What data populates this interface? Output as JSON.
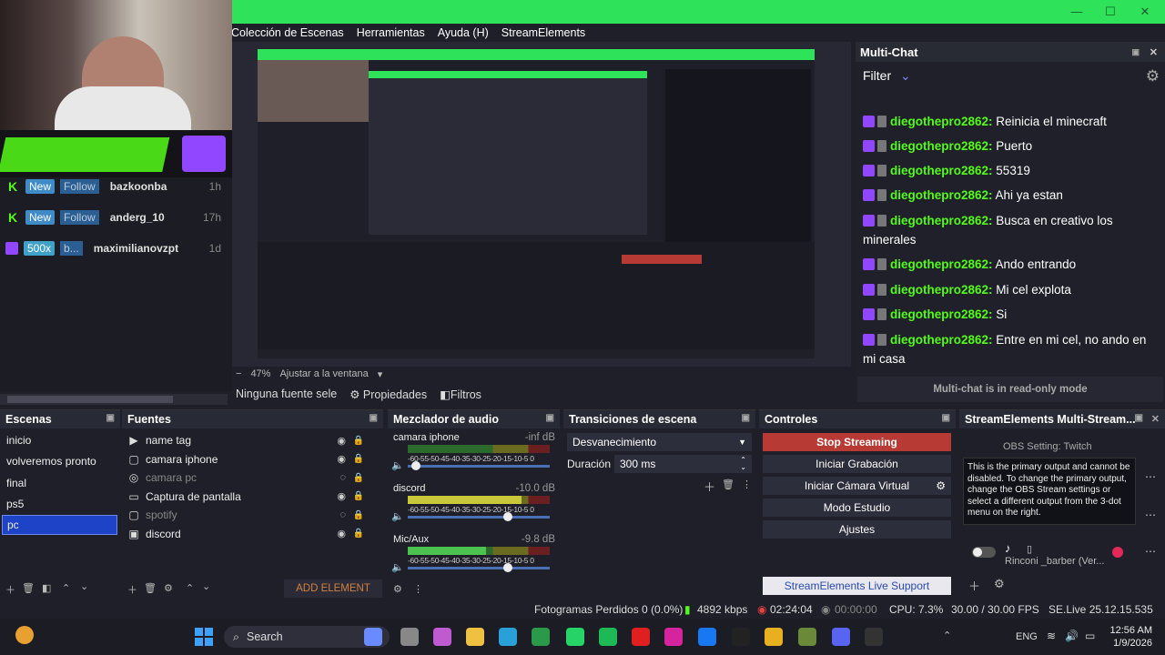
{
  "window": {
    "min": "—",
    "max": "☐",
    "close": "✕"
  },
  "menu": [
    "Colección de Escenas",
    "Herramientas",
    "Ayuda (H)",
    "StreamElements"
  ],
  "sidebar": {
    "rows": [
      {
        "platform": "kick",
        "badge": "New",
        "action": "Follow",
        "name": "bazkoonba",
        "time": "1h"
      },
      {
        "platform": "kick",
        "badge": "New",
        "action": "Follow",
        "name": "anderg_10",
        "time": "17h"
      },
      {
        "platform": "twitch",
        "badge": "500x",
        "action": "b...",
        "name": "maximilianovzpt",
        "time": "1d"
      }
    ]
  },
  "preview": {
    "zoom": "47%",
    "fit": "Ajustar a la ventana"
  },
  "sourcebar": {
    "none": "Ninguna fuente sele",
    "properties": "Propiedades",
    "filters": "Filtros"
  },
  "chat": {
    "title": "Multi-Chat",
    "filter": "Filter",
    "footer": "Multi-chat is in read-only mode",
    "messages": [
      {
        "user": "diegothepro2862:",
        "text": "Reinicia el minecraft"
      },
      {
        "user": "diegothepro2862:",
        "text": "Puerto"
      },
      {
        "user": "diegothepro2862:",
        "text": "55319"
      },
      {
        "user": "diegothepro2862:",
        "text": "Ahi ya estan"
      },
      {
        "user": "diegothepro2862:",
        "text": "Busca en creativo los minerales"
      },
      {
        "user": "diegothepro2862:",
        "text": "Ando entrando"
      },
      {
        "user": "diegothepro2862:",
        "text": "Mi cel explota"
      },
      {
        "user": "diegothepro2862:",
        "text": "Si"
      },
      {
        "user": "diegothepro2862:",
        "text": "Entre en mi cel, no ando en mi casa"
      }
    ]
  },
  "scenes": {
    "title": "Escenas",
    "items": [
      "inicio",
      "volveremos pronto",
      "final",
      "ps5",
      "pc"
    ],
    "selected": "pc"
  },
  "sources": {
    "title": "Fuentes",
    "add": "ADD ELEMENT",
    "items": [
      {
        "name": "name tag",
        "icon": "▶",
        "hidden": false
      },
      {
        "name": "camara iphone",
        "icon": "▢",
        "hidden": false
      },
      {
        "name": "camara pc",
        "icon": "◎",
        "hidden": true
      },
      {
        "name": "Captura de pantalla",
        "icon": "▭",
        "hidden": false
      },
      {
        "name": "spotify",
        "icon": "▢",
        "hidden": true
      },
      {
        "name": "discord",
        "icon": "▣",
        "hidden": false
      }
    ]
  },
  "mixer": {
    "title": "Mezclador de audio",
    "ticks": "-60-55-50-45-40-35-30-25-20-15-10-5 0",
    "channels": [
      {
        "name": "camara iphone",
        "level": "-inf dB",
        "fill": 0.0,
        "volume": 0.03
      },
      {
        "name": "discord",
        "level": "-10.0 dB",
        "fill": 0.8,
        "volume": 0.72
      },
      {
        "name": "Mic/Aux",
        "level": "-9.8 dB",
        "fill": 0.55,
        "volume": 0.72
      }
    ]
  },
  "transitions": {
    "title": "Transiciones de escena",
    "selected": "Desvanecimiento",
    "duration_label": "Duración",
    "duration": "300 ms"
  },
  "controls": {
    "title": "Controles",
    "buttons": [
      "Stop Streaming",
      "Iniciar Grabación",
      "Iniciar Cámara Virtual",
      "Modo Estudio",
      "Ajustes"
    ],
    "support": "StreamElements Live Support"
  },
  "se": {
    "title": "StreamElements Multi-Stream...",
    "setting": "OBS Setting: Twitch",
    "tooltip": "This is the primary output and cannot be disabled. To change the primary output, change the OBS Stream settings or select a different output from the 3-dot menu on the right.",
    "account": "Rinconi _barber (Ver..."
  },
  "status": {
    "dropped": "Fotogramas Perdidos 0 (0.0%)",
    "kbps": "4892 kbps",
    "live": "02:24:04",
    "rec": "00:00:00",
    "cpu": "CPU: 7.3%",
    "fps": "30.00 / 30.00 FPS",
    "version": "SE.Live 25.12.15.535"
  },
  "taskbar": {
    "search": "Search",
    "lang": "ENG",
    "time": "12:56 AM",
    "date": "1/9/2026"
  },
  "colors": {
    "green": "#2ee35a",
    "kick": "#53fc18",
    "twitch": "#9146ff",
    "selected": "#1e43c7",
    "stop": "#b73a35"
  }
}
